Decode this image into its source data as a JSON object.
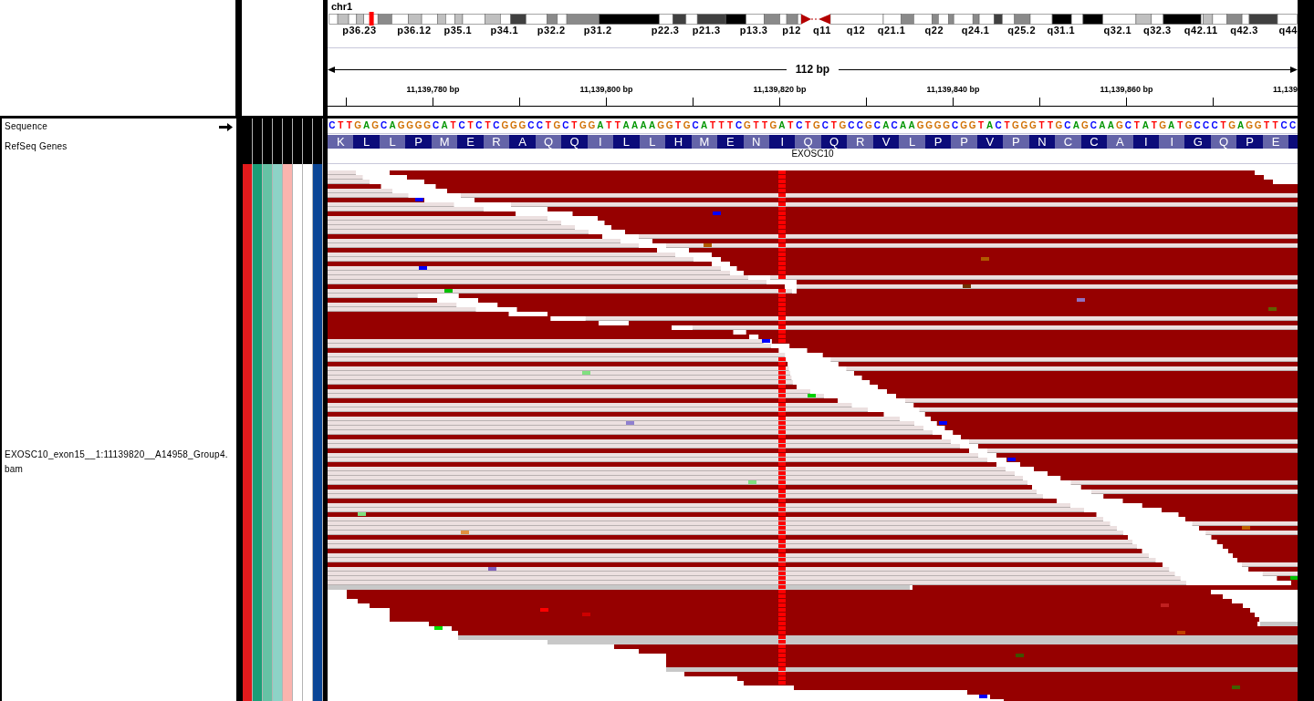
{
  "header": {
    "chromosome": "chr1",
    "cytobands": [
      "p36.23",
      "p36.12",
      "p35.1",
      "p34.1",
      "p32.2",
      "p31.2",
      "p22.3",
      "p21.3",
      "p13.3",
      "p12",
      "q11",
      "q12",
      "q21.1",
      "q22",
      "q24.1",
      "q25.2",
      "q31.1",
      "q32.1",
      "q32.3",
      "q42.11",
      "q42.3",
      "q44"
    ],
    "span": "112 bp",
    "ruler_labels": [
      "11,139,780 bp",
      "11,139,800 bp",
      "11,139,820 bp",
      "11,139,840 bp",
      "11,139,860 bp",
      "11,139"
    ]
  },
  "tracks": [
    {
      "kind": "sequence",
      "name": "Sequence",
      "forward_strand": true,
      "bases": [
        {
          "base": "C",
          "color": "#0000ff"
        },
        {
          "base": "T",
          "color": "#ff0000"
        },
        {
          "base": "T",
          "color": "#ff0000"
        },
        {
          "base": "G",
          "color": "#d17105"
        },
        {
          "base": "A",
          "color": "#009600"
        },
        {
          "base": "G",
          "color": "#d17105"
        },
        {
          "base": "C",
          "color": "#0000ff"
        },
        {
          "base": "A",
          "color": "#009600"
        },
        {
          "base": "G",
          "color": "#d17105"
        },
        {
          "base": "G",
          "color": "#d17105"
        },
        {
          "base": "G",
          "color": "#d17105"
        },
        {
          "base": "G",
          "color": "#d17105"
        },
        {
          "base": "C",
          "color": "#0000ff"
        },
        {
          "base": "A",
          "color": "#009600"
        },
        {
          "base": "T",
          "color": "#ff0000"
        },
        {
          "base": "C",
          "color": "#0000ff"
        },
        {
          "base": "T",
          "color": "#ff0000"
        },
        {
          "base": "C",
          "color": "#0000ff"
        },
        {
          "base": "T",
          "color": "#ff0000"
        },
        {
          "base": "C",
          "color": "#0000ff"
        },
        {
          "base": "G",
          "color": "#d17105"
        },
        {
          "base": "G",
          "color": "#d17105"
        },
        {
          "base": "G",
          "color": "#d17105"
        },
        {
          "base": "C",
          "color": "#0000ff"
        },
        {
          "base": "C",
          "color": "#0000ff"
        },
        {
          "base": "T",
          "color": "#ff0000"
        },
        {
          "base": "G",
          "color": "#d17105"
        },
        {
          "base": "C",
          "color": "#0000ff"
        },
        {
          "base": "T",
          "color": "#ff0000"
        },
        {
          "base": "G",
          "color": "#d17105"
        },
        {
          "base": "G",
          "color": "#d17105"
        },
        {
          "base": "A",
          "color": "#009600"
        },
        {
          "base": "T",
          "color": "#ff0000"
        },
        {
          "base": "T",
          "color": "#ff0000"
        },
        {
          "base": "A",
          "color": "#009600"
        },
        {
          "base": "A",
          "color": "#009600"
        },
        {
          "base": "A",
          "color": "#009600"
        },
        {
          "base": "A",
          "color": "#009600"
        },
        {
          "base": "G",
          "color": "#d17105"
        },
        {
          "base": "G",
          "color": "#d17105"
        },
        {
          "base": "T",
          "color": "#ff0000"
        },
        {
          "base": "G",
          "color": "#d17105"
        },
        {
          "base": "C",
          "color": "#0000ff"
        },
        {
          "base": "A",
          "color": "#009600"
        },
        {
          "base": "T",
          "color": "#ff0000"
        },
        {
          "base": "T",
          "color": "#ff0000"
        },
        {
          "base": "T",
          "color": "#ff0000"
        },
        {
          "base": "C",
          "color": "#0000ff"
        },
        {
          "base": "G",
          "color": "#d17105"
        },
        {
          "base": "T",
          "color": "#ff0000"
        },
        {
          "base": "T",
          "color": "#ff0000"
        },
        {
          "base": "G",
          "color": "#d17105"
        },
        {
          "base": "A",
          "color": "#009600"
        },
        {
          "base": "T",
          "color": "#ff0000"
        },
        {
          "base": "C",
          "color": "#0000ff"
        },
        {
          "base": "T",
          "color": "#ff0000"
        },
        {
          "base": "G",
          "color": "#d17105"
        },
        {
          "base": "C",
          "color": "#0000ff"
        },
        {
          "base": "T",
          "color": "#ff0000"
        },
        {
          "base": "G",
          "color": "#d17105"
        },
        {
          "base": "C",
          "color": "#0000ff"
        },
        {
          "base": "C",
          "color": "#0000ff"
        },
        {
          "base": "G",
          "color": "#d17105"
        },
        {
          "base": "C",
          "color": "#0000ff"
        },
        {
          "base": "A",
          "color": "#009600"
        },
        {
          "base": "C",
          "color": "#0000ff"
        },
        {
          "base": "A",
          "color": "#009600"
        },
        {
          "base": "A",
          "color": "#009600"
        },
        {
          "base": "G",
          "color": "#d17105"
        },
        {
          "base": "G",
          "color": "#d17105"
        },
        {
          "base": "G",
          "color": "#d17105"
        },
        {
          "base": "G",
          "color": "#d17105"
        },
        {
          "base": "C",
          "color": "#0000ff"
        },
        {
          "base": "G",
          "color": "#d17105"
        },
        {
          "base": "G",
          "color": "#d17105"
        },
        {
          "base": "T",
          "color": "#ff0000"
        },
        {
          "base": "A",
          "color": "#009600"
        },
        {
          "base": "C",
          "color": "#0000ff"
        },
        {
          "base": "T",
          "color": "#ff0000"
        },
        {
          "base": "G",
          "color": "#d17105"
        },
        {
          "base": "G",
          "color": "#d17105"
        },
        {
          "base": "G",
          "color": "#d17105"
        },
        {
          "base": "T",
          "color": "#ff0000"
        },
        {
          "base": "T",
          "color": "#ff0000"
        },
        {
          "base": "G",
          "color": "#d17105"
        },
        {
          "base": "C",
          "color": "#0000ff"
        },
        {
          "base": "A",
          "color": "#009600"
        },
        {
          "base": "G",
          "color": "#d17105"
        },
        {
          "base": "C",
          "color": "#0000ff"
        },
        {
          "base": "A",
          "color": "#009600"
        },
        {
          "base": "A",
          "color": "#009600"
        },
        {
          "base": "G",
          "color": "#d17105"
        },
        {
          "base": "C",
          "color": "#0000ff"
        },
        {
          "base": "T",
          "color": "#ff0000"
        },
        {
          "base": "A",
          "color": "#009600"
        },
        {
          "base": "T",
          "color": "#ff0000"
        },
        {
          "base": "G",
          "color": "#d17105"
        },
        {
          "base": "A",
          "color": "#009600"
        },
        {
          "base": "T",
          "color": "#ff0000"
        },
        {
          "base": "G",
          "color": "#d17105"
        },
        {
          "base": "C",
          "color": "#0000ff"
        },
        {
          "base": "C",
          "color": "#0000ff"
        },
        {
          "base": "C",
          "color": "#0000ff"
        },
        {
          "base": "T",
          "color": "#ff0000"
        },
        {
          "base": "G",
          "color": "#d17105"
        },
        {
          "base": "A",
          "color": "#009600"
        },
        {
          "base": "G",
          "color": "#d17105"
        },
        {
          "base": "G",
          "color": "#d17105"
        },
        {
          "base": "T",
          "color": "#ff0000"
        },
        {
          "base": "T",
          "color": "#ff0000"
        },
        {
          "base": "C",
          "color": "#0000ff"
        },
        {
          "base": "C",
          "color": "#0000ff"
        }
      ]
    },
    {
      "kind": "gene",
      "name": "RefSeq Genes",
      "gene": "EXOSC10",
      "amino_acids": [
        "K",
        "L",
        "L",
        "P",
        "M",
        "E",
        "R",
        "A",
        "Q",
        "Q",
        "I",
        "L",
        "L",
        "H",
        "M",
        "E",
        "N",
        "I",
        "Q",
        "Q",
        "R",
        "V",
        "L",
        "P",
        "P",
        "V",
        "P",
        "N",
        "C",
        "C",
        "A",
        "I",
        "I",
        "G",
        "Q",
        "P",
        "E"
      ]
    },
    {
      "kind": "alignment",
      "name": "EXOSC10_exon15__1:11139820__A14958_Group4.bam"
    }
  ],
  "attribute_columns": [
    {
      "color": "#e31a1c"
    },
    {
      "color": "#1b9e77"
    },
    {
      "color": "#66c2a5"
    },
    {
      "color": "#8dd3c7"
    },
    {
      "color": "#fbb4ae"
    },
    {
      "color": "#ffffff"
    },
    {
      "color": "#ffffff"
    },
    {
      "color": "#0b4696"
    }
  ]
}
